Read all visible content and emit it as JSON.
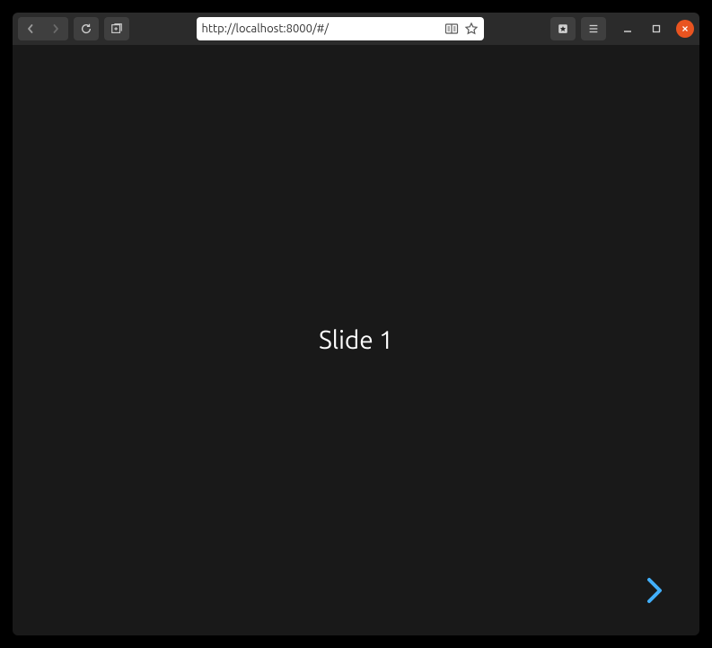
{
  "browser": {
    "url": "http://localhost:8000/#/"
  },
  "slide": {
    "title": "Slide 1"
  }
}
